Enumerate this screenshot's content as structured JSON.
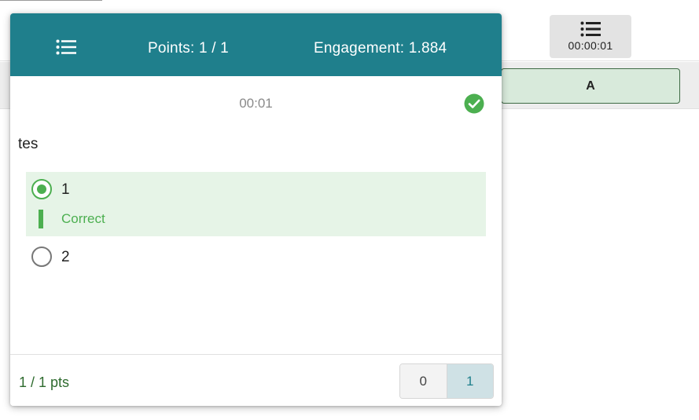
{
  "background": {
    "timer_value": "00:00:01",
    "answer_label": "A"
  },
  "popup": {
    "header": {
      "points_text": "Points: 1 / 1",
      "engagement_text": "Engagement: 1.884"
    },
    "question_timer": "00:01",
    "question_text": "tes",
    "options": [
      {
        "label": "1",
        "selected": true,
        "feedback": "Correct"
      },
      {
        "label": "2",
        "selected": false
      }
    ],
    "footer": {
      "points_summary": "1 / 1 pts",
      "score_options": [
        "0",
        "1"
      ],
      "selected_score": "1"
    }
  },
  "colors": {
    "header_teal": "#1f7f8c",
    "correct_green": "#4caf50",
    "correct_bg": "#e6f4e7",
    "answer_button_bg": "#d8eadb"
  },
  "icons": [
    "list-icon",
    "check-circle-icon",
    "radio-checked-icon",
    "radio-unchecked-icon"
  ]
}
